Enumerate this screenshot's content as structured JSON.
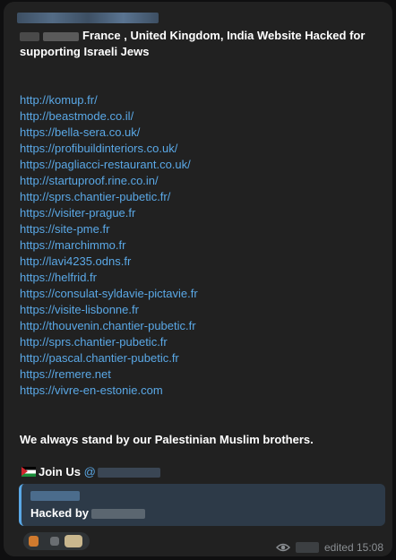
{
  "post": {
    "headline": "France , United Kingdom, India Website Hacked for supporting Israeli Jews",
    "links": [
      "http://komup.fr/",
      "http://beastmode.co.il/",
      "https://bella-sera.co.uk/",
      "https://profibuildinteriors.co.uk/",
      "https://pagliacci-restaurant.co.uk/",
      "http://startuproof.rine.co.in/",
      "http://sprs.chantier-pubetic.fr/",
      "https://visiter-prague.fr",
      "https://site-pme.fr",
      "https://marchimmo.fr",
      "http://lavi4235.odns.fr",
      "https://helfrid.fr",
      "https://consulat-syldavie-pictavie.fr",
      "https://visite-lisbonne.fr",
      "http://thouvenin.chantier-pubetic.fr",
      "http://sprs.chantier-pubetic.fr",
      "http://pascal.chantier-pubetic.fr",
      "https://remere.net",
      "https://vivre-en-estonie.com"
    ],
    "statement": "We always stand by our Palestinian Muslim brothers.",
    "join_label": "Join Us",
    "mention_prefix": "@",
    "quote_text": "Hacked by",
    "edited_time": "edited 15:08"
  },
  "icons": {
    "flag": "palestine-flag-icon",
    "views": "eye-icon"
  },
  "colors": {
    "bubble": "#212121",
    "link": "#5aa8e6",
    "quote_bg": "#2d3a48",
    "meta": "#8a8e92"
  }
}
